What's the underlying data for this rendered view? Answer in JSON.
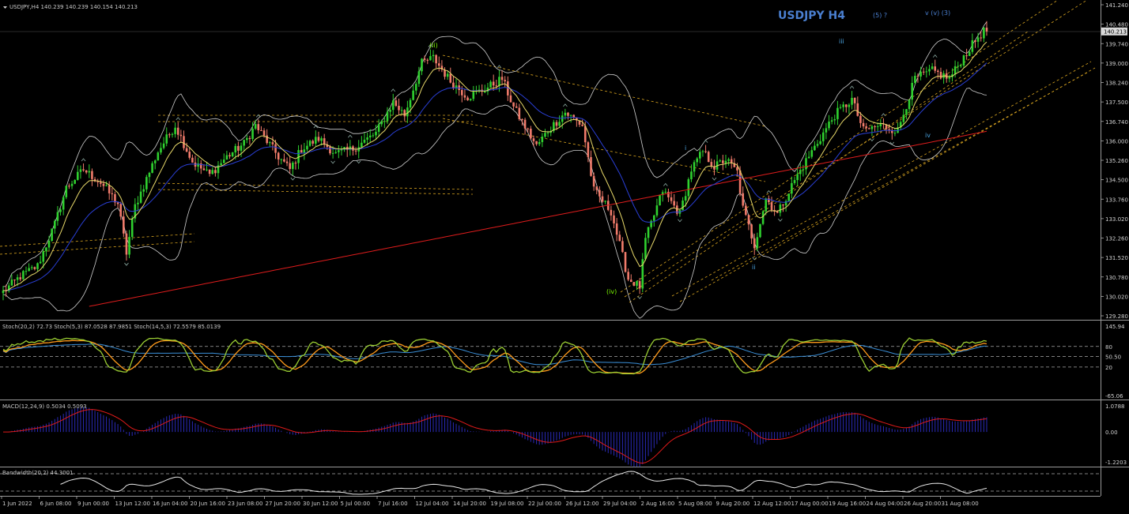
{
  "header": {
    "symbol_line": "USDJPY,H4  140.239 140.239 140.154 140.213",
    "title": "USDJPY H4",
    "wave_note_1": "(5) ?",
    "wave_note_2": "v (v) (3)"
  },
  "wave_labels": [
    {
      "text": "(ii)",
      "color": "#7cfc00"
    },
    {
      "text": "(iv)",
      "color": "#7cfc00"
    },
    {
      "text": "i",
      "color": "#4aa3df"
    },
    {
      "text": "ii",
      "color": "#4aa3df"
    },
    {
      "text": "iii",
      "color": "#4aa3df"
    },
    {
      "text": "iv",
      "color": "#4aa3df"
    }
  ],
  "colors": {
    "background": "#000000",
    "bull_candle": "#2fd12f",
    "bear_candle": "#f07b6b",
    "sma_long": "#dd1c1c",
    "ema_mid": "#2a3fd6",
    "ema_fast": "#e8d96a",
    "bollinger": "#cfcfcf",
    "channel": "#d9a520",
    "stoch_fast": "#9acd32",
    "stoch_slow": "#ff9a1a",
    "stoch_trend": "#3a8fd8",
    "macd_hist": "#2a2ab8",
    "macd_signal": "#e01a1a",
    "bandwidth": "#e8e8e8",
    "axis_text": "#d0d0d0",
    "title_blue": "#4a7fd0"
  },
  "chart_data": [
    {
      "type": "candlestick",
      "title": "USDJPY H4",
      "x_ticks": [
        "1 Jun 2022",
        "6 Jun 08:00",
        "9 Jun 00:00",
        "13 Jun 12:00",
        "16 Jun 04:00",
        "20 Jun 16:00",
        "23 Jun 08:00",
        "27 Jun 20:00",
        "30 Jun 12:00",
        "5 Jul 00:00",
        "7 Jul 16:00",
        "12 Jul 04:00",
        "14 Jul 20:00",
        "19 Jul 08:00",
        "22 Jul 00:00",
        "26 Jul 12:00",
        "29 Jul 04:00",
        "2 Aug 16:00",
        "5 Aug 08:00",
        "9 Aug 20:00",
        "12 Aug 12:00",
        "17 Aug 00:00",
        "19 Aug 16:00",
        "24 Aug 04:00",
        "26 Aug 20:00",
        "31 Aug 08:00"
      ],
      "y_ticks": [
        "141.240",
        "140.480",
        "139.740",
        "139.000",
        "138.240",
        "137.500",
        "136.740",
        "136.000",
        "135.260",
        "134.500",
        "133.760",
        "133.020",
        "132.260",
        "131.520",
        "130.780",
        "130.020",
        "129.280"
      ],
      "ylim": [
        129.28,
        141.24
      ],
      "last_price": "140.213",
      "price_path": [
        [
          0,
          130.2
        ],
        [
          6,
          130.8
        ],
        [
          12,
          131.2
        ],
        [
          18,
          132.8
        ],
        [
          22,
          134.2
        ],
        [
          28,
          134.9
        ],
        [
          34,
          134.4
        ],
        [
          40,
          133.6
        ],
        [
          43,
          131.7
        ],
        [
          46,
          133.5
        ],
        [
          54,
          135.6
        ],
        [
          60,
          136.6
        ],
        [
          66,
          135.2
        ],
        [
          72,
          134.7
        ],
        [
          78,
          135.4
        ],
        [
          84,
          135.9
        ],
        [
          88,
          136.6
        ],
        [
          96,
          135.4
        ],
        [
          100,
          134.9
        ],
        [
          104,
          135.7
        ],
        [
          110,
          136.1
        ],
        [
          116,
          135.5
        ],
        [
          122,
          135.7
        ],
        [
          130,
          136.3
        ],
        [
          136,
          137.5
        ],
        [
          140,
          137.0
        ],
        [
          146,
          139.0
        ],
        [
          150,
          139.2
        ],
        [
          156,
          138.3
        ],
        [
          162,
          137.7
        ],
        [
          168,
          138.0
        ],
        [
          174,
          138.4
        ],
        [
          178,
          137.3
        ],
        [
          186,
          135.8
        ],
        [
          190,
          136.4
        ],
        [
          196,
          137.1
        ],
        [
          202,
          136.6
        ],
        [
          206,
          134.1
        ],
        [
          212,
          133.3
        ],
        [
          218,
          130.7
        ],
        [
          222,
          130.4
        ],
        [
          224,
          132.2
        ],
        [
          230,
          134.1
        ],
        [
          236,
          133.2
        ],
        [
          240,
          134.9
        ],
        [
          244,
          135.6
        ],
        [
          248,
          135.0
        ],
        [
          252,
          135.3
        ],
        [
          256,
          134.8
        ],
        [
          258,
          133.4
        ],
        [
          262,
          132.0
        ],
        [
          266,
          133.8
        ],
        [
          270,
          133.2
        ],
        [
          276,
          134.5
        ],
        [
          282,
          135.6
        ],
        [
          290,
          137.0
        ],
        [
          296,
          137.6
        ],
        [
          300,
          136.4
        ],
        [
          306,
          136.6
        ],
        [
          312,
          136.4
        ],
        [
          318,
          138.4
        ],
        [
          324,
          138.7
        ],
        [
          330,
          138.4
        ],
        [
          336,
          139.4
        ],
        [
          340,
          140.0
        ],
        [
          342,
          140.21
        ]
      ]
    },
    {
      "type": "line",
      "title": "Stoch Oscillators",
      "label": "Stoch(20,2) 72.73  Stoch(5,3) 87.0528 87.9851  Stoch(14,5,3) 72.5579 85.0139",
      "y_ticks": [
        "145.94",
        "80",
        "50.50",
        "20",
        "-65.06"
      ],
      "ylim": [
        -65.06,
        145.94
      ]
    },
    {
      "type": "line",
      "title": "MACD",
      "label": "MACD(12,24,9) 0.5034 0.5093",
      "y_ticks": [
        "1.0788",
        "0.00",
        "-1.2203"
      ],
      "ylim": [
        -1.2203,
        1.0788
      ]
    },
    {
      "type": "line",
      "title": "Bandwidth",
      "label": "Bandwidth(20,2) 44.3001",
      "y_ticks": [],
      "ylim": [
        0,
        100
      ]
    }
  ]
}
